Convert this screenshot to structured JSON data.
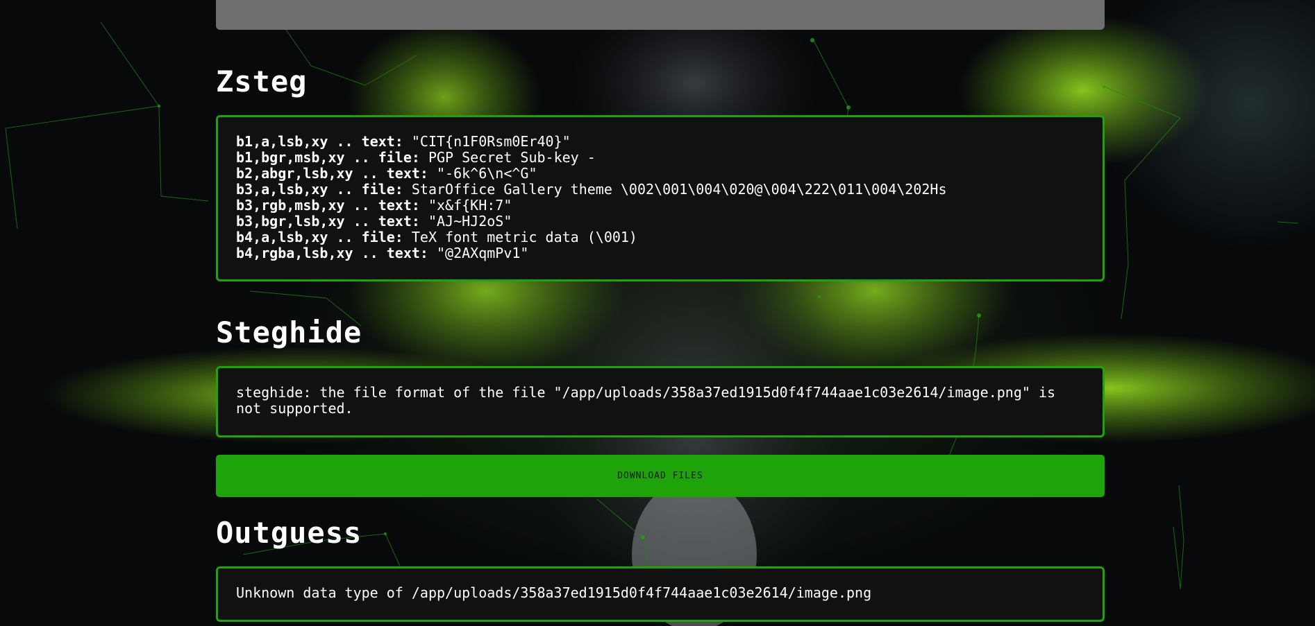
{
  "zsteg": {
    "title": "Zsteg",
    "lines": [
      {
        "key": "b1,a,lsb,xy .. text:",
        "value": " \"CIT{n1F0Rsm0Er40}\""
      },
      {
        "key": "b1,bgr,msb,xy .. file:",
        "value": " PGP Secret Sub-key -"
      },
      {
        "key": "b2,abgr,lsb,xy .. text:",
        "value": " \"-6k^6\\n<^G\""
      },
      {
        "key": "b3,a,lsb,xy .. file:",
        "value": " StarOffice Gallery theme \\002\\001\\004\\020@\\004\\222\\011\\004\\202Hs"
      },
      {
        "key": "b3,rgb,msb,xy .. text:",
        "value": " \"x&f{KH:7\""
      },
      {
        "key": "b3,bgr,lsb,xy .. text:",
        "value": " \"AJ~HJ2oS\""
      },
      {
        "key": "b4,a,lsb,xy .. file:",
        "value": " TeX font metric data (\\001)"
      },
      {
        "key": "b4,rgba,lsb,xy .. text:",
        "value": " \"@2AXqmPv1\""
      }
    ]
  },
  "steghide": {
    "title": "Steghide",
    "output": "steghide: the file format of the file \"/app/uploads/358a37ed1915d0f4f744aae1c03e2614/image.png\" is not supported."
  },
  "download": {
    "label": "DOWNLOAD FILES"
  },
  "outguess": {
    "title": "Outguess",
    "output": "Unknown data type of /app/uploads/358a37ed1915d0f4f744aae1c03e2614/image.png"
  },
  "colors": {
    "accent": "#1ea30a",
    "panel_bg": "#111111",
    "top_box_bg": "#6e6e6e",
    "text": "#ffffff"
  }
}
